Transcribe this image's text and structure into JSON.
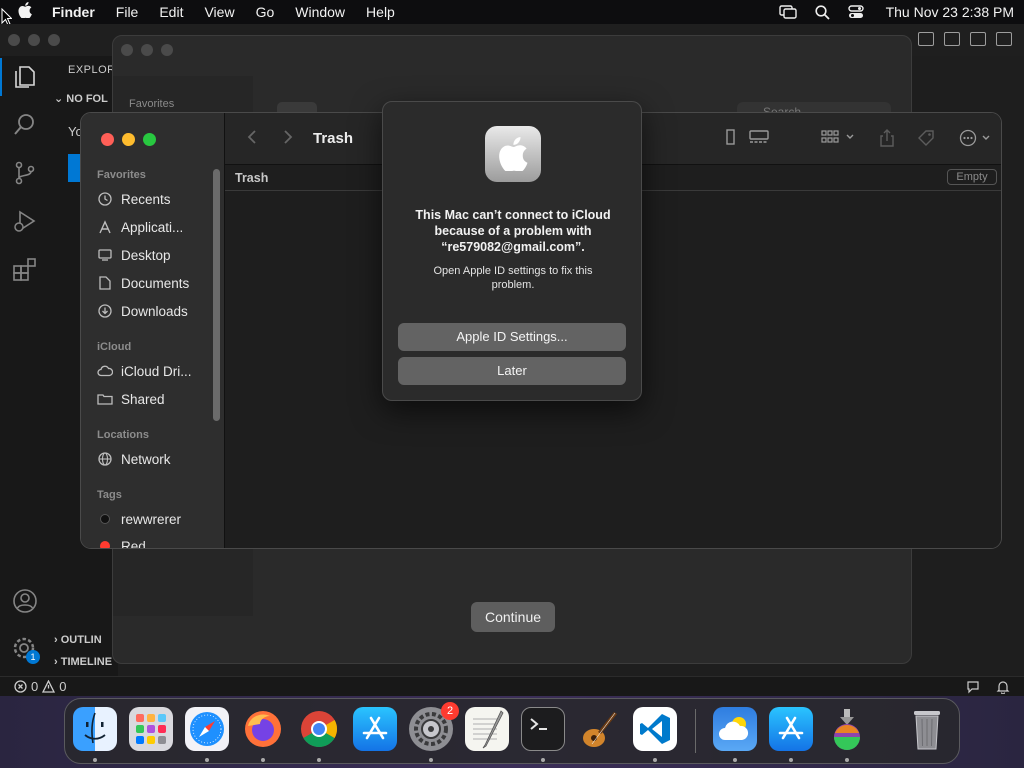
{
  "menubar": {
    "app_name": "Finder",
    "menus": [
      "File",
      "Edit",
      "View",
      "Go",
      "Window",
      "Help"
    ],
    "clock": "Thu Nov 23  2:38 PM",
    "icons": [
      "apple-icon",
      "screen-mirroring-icon",
      "spotlight-icon",
      "control-center-icon"
    ]
  },
  "vscode": {
    "explorer_title": "EXPLOR",
    "no_folder_label": "NO FOL",
    "welcome_text": "Yo",
    "outline_label": "OUTLIN",
    "timeline_label": "TIMELINE",
    "status": {
      "errors": "0",
      "warnings": "0"
    },
    "settings_badge": "1"
  },
  "backwin": {
    "favorites_label": "Favorites",
    "search_placeholder": "Search",
    "continue_label": "Continue"
  },
  "finder": {
    "title": "Trash",
    "path_label": "Trash",
    "empty_button": "Empty",
    "sections": {
      "favorites": "Favorites",
      "icloud": "iCloud",
      "locations": "Locations",
      "tags": "Tags"
    },
    "favorites": [
      {
        "label": "Recents",
        "icon": "clock-icon"
      },
      {
        "label": "Applicati...",
        "icon": "applications-icon"
      },
      {
        "label": "Desktop",
        "icon": "desktop-icon"
      },
      {
        "label": "Documents",
        "icon": "document-icon"
      },
      {
        "label": "Downloads",
        "icon": "download-icon"
      }
    ],
    "icloud": [
      {
        "label": "iCloud Dri...",
        "icon": "cloud-icon"
      },
      {
        "label": "Shared",
        "icon": "shared-folder-icon"
      }
    ],
    "locations": [
      {
        "label": "Network",
        "icon": "network-icon"
      }
    ],
    "tags": [
      {
        "label": "rewwrerer",
        "color": "#111111"
      },
      {
        "label": "Red",
        "color": "#ff3b30"
      }
    ]
  },
  "alert": {
    "headline": "This Mac can’t connect to iCloud because of a problem with “re579082@gmail.com”.",
    "message": "Open Apple ID settings to fix this problem.",
    "primary_button": "Apple ID Settings...",
    "secondary_button": "Later"
  },
  "dock": {
    "apps": [
      "finder-icon",
      "launchpad-icon",
      "safari-icon",
      "firefox-icon",
      "chrome-icon",
      "app-store-icon",
      "system-settings-icon",
      "textedit-icon",
      "terminal-icon",
      "garageband-icon",
      "vscode-icon",
      "weather-icon",
      "app-store-icon",
      "installer-icon",
      "trash-icon"
    ],
    "settings_badge": "2"
  }
}
